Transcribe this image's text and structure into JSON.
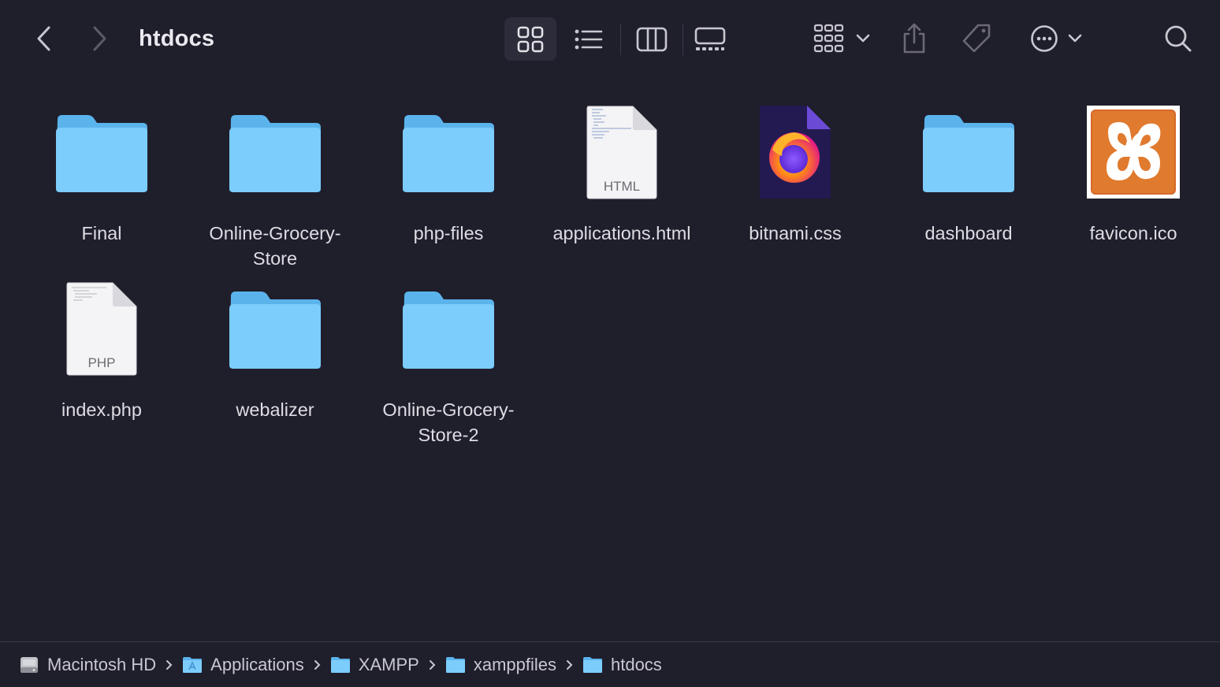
{
  "window": {
    "title": "htdocs"
  },
  "toolbar": {
    "back_icon": "chevron-left-icon",
    "forward_icon": "chevron-right-icon",
    "views": [
      "icon-view",
      "list-view",
      "column-view",
      "gallery-view"
    ],
    "group_icon": "group-by-icon",
    "share_icon": "share-icon",
    "tag_icon": "tag-icon",
    "more_icon": "more-actions-icon",
    "search_icon": "search-icon"
  },
  "files": [
    {
      "name": "Final",
      "kind": "folder"
    },
    {
      "name": "Online-Grocery-Store",
      "line1": "Online-Grocery-",
      "line2": "Store",
      "kind": "folder"
    },
    {
      "name": "php-files",
      "kind": "folder"
    },
    {
      "name": "applications.html",
      "kind": "html",
      "badge": "HTML"
    },
    {
      "name": "bitnami.css",
      "kind": "css"
    },
    {
      "name": "dashboard",
      "kind": "folder"
    },
    {
      "name": "favicon.ico",
      "kind": "ico"
    },
    {
      "name": "index.php",
      "kind": "php",
      "badge": "PHP"
    },
    {
      "name": "webalizer",
      "kind": "folder"
    },
    {
      "name": "Online-Grocery-Store-2",
      "line1": "Online-Grocery-",
      "line2": "Store-2",
      "kind": "folder"
    }
  ],
  "pathbar": [
    "Macintosh HD",
    "Applications",
    "XAMPP",
    "xamppfiles",
    "htdocs"
  ],
  "colors": {
    "folder": "#7ccdfc",
    "folder_dark": "#5bb3ec",
    "background": "#1f1e2b",
    "accent_orange": "#e07a2e"
  }
}
